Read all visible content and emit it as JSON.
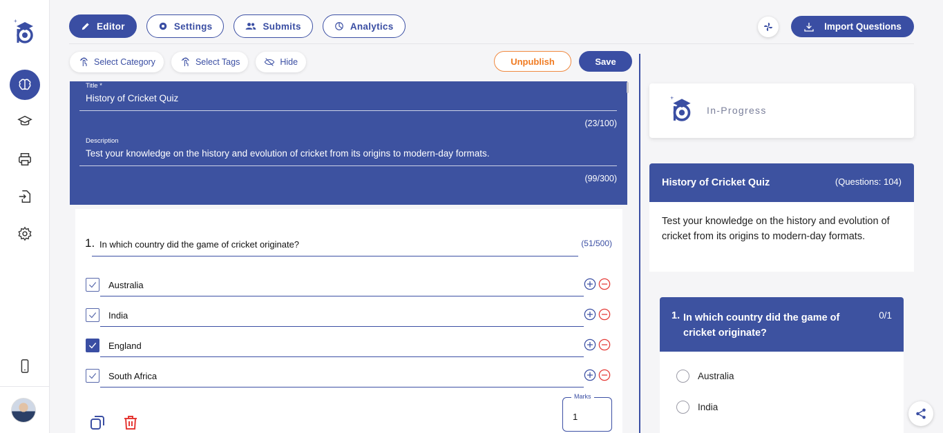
{
  "sidebar": {
    "items": [
      {
        "icon": "brain-icon",
        "active": true
      },
      {
        "icon": "graduation-cap-icon",
        "active": false
      },
      {
        "icon": "printer-icon",
        "active": false
      },
      {
        "icon": "file-import-icon",
        "active": false
      },
      {
        "icon": "gear-icon",
        "active": false
      }
    ],
    "bottom_icon": "mobile-icon"
  },
  "tabs": [
    {
      "label": "Editor",
      "icon": "pencil-icon",
      "active": true
    },
    {
      "label": "Settings",
      "icon": "gear-icon",
      "active": false
    },
    {
      "label": "Submits",
      "icon": "users-icon",
      "active": false
    },
    {
      "label": "Analytics",
      "icon": "pie-chart-icon",
      "active": false
    }
  ],
  "toolbar": {
    "import_label": "Import Questions",
    "unpublish_label": "Unpublish",
    "save_label": "Save"
  },
  "chips": [
    {
      "label": "Select Category"
    },
    {
      "label": "Select Tags"
    },
    {
      "label": "Hide"
    }
  ],
  "quiz": {
    "title_label": "Title *",
    "title": "History of Cricket Quiz",
    "title_count": "(23/100)",
    "description_label": "Description",
    "description": "Test your knowledge on the history and evolution of cricket from its origins to modern-day formats.",
    "description_count": "(99/300)"
  },
  "question": {
    "number": "1.",
    "text": "In which country did the game of cricket originate?",
    "count": "(51/500)",
    "options": [
      {
        "text": "Australia",
        "checked": false
      },
      {
        "text": "India",
        "checked": false
      },
      {
        "text": "England",
        "checked": true
      },
      {
        "text": "South Africa",
        "checked": false
      }
    ],
    "marks_label": "Marks",
    "marks_value": "1"
  },
  "preview": {
    "status": "In-Progress",
    "title": "History of Cricket Quiz",
    "questions_count": "(Questions: 104)",
    "description": "Test your knowledge on the history and evolution of cricket from its origins to modern-day formats.",
    "q_number": "1.",
    "q_text": "In which country did the game of cricket originate?",
    "q_score": "0/1",
    "options": [
      "Australia",
      "India"
    ]
  },
  "colors": {
    "primary": "#3d52a0",
    "accent_orange": "#f07b22",
    "danger": "#e53935"
  }
}
